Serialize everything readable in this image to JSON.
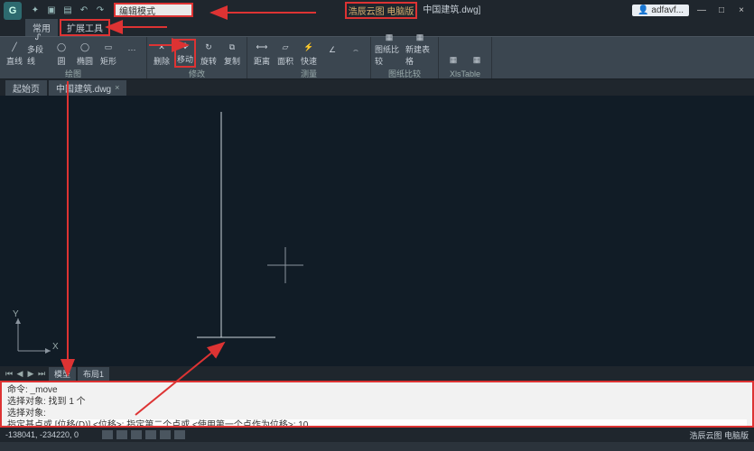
{
  "title_bar": {
    "search_mode": "编辑模式",
    "brand": "浩辰云图 电脑版",
    "doc_suffix": "中国建筑.dwg]",
    "user": "adfavf...",
    "minimize": "—",
    "maximize": "□",
    "close": "×"
  },
  "menu_tabs": {
    "common": "常用",
    "extend": "扩展工具"
  },
  "ribbon": {
    "groups": {
      "draw": {
        "label": "绘图",
        "tools": {
          "line": "直线",
          "pline": "多段线",
          "circle": "圆",
          "ellipse": "椭圆",
          "rect": "矩形"
        }
      },
      "modify": {
        "label": "修改",
        "tools": {
          "erase": "删除",
          "move": "移动",
          "rotate": "旋转",
          "copy": "复制"
        }
      },
      "measure": {
        "label": "测量",
        "tools": {
          "dist": "距离",
          "area": "面积",
          "quick": "快速"
        }
      },
      "compare": {
        "label": "图纸比较",
        "tools": {
          "compare": "图纸比较",
          "newtable": "新建表格"
        }
      },
      "xlstable": {
        "label": "XlsTable"
      }
    }
  },
  "doc_tabs": {
    "start": "起始页",
    "active": "中国建筑.dwg",
    "close": "×"
  },
  "ucs": {
    "x": "X",
    "y": "Y"
  },
  "model_tabs": {
    "model": "模型",
    "layout1": "布局1"
  },
  "command": {
    "l1": "命令: _move",
    "l2": "选择对象: 找到 1 个",
    "l3": "选择对象:",
    "l4": "指定基点或 [位移(D)] <位移>:   指定第二个点或 <使用第一个点作为位移>: 10"
  },
  "status": {
    "coords": "-138041, -234220, 0",
    "right": "浩辰云图 电脑版"
  },
  "icons": {
    "user": "👤"
  }
}
